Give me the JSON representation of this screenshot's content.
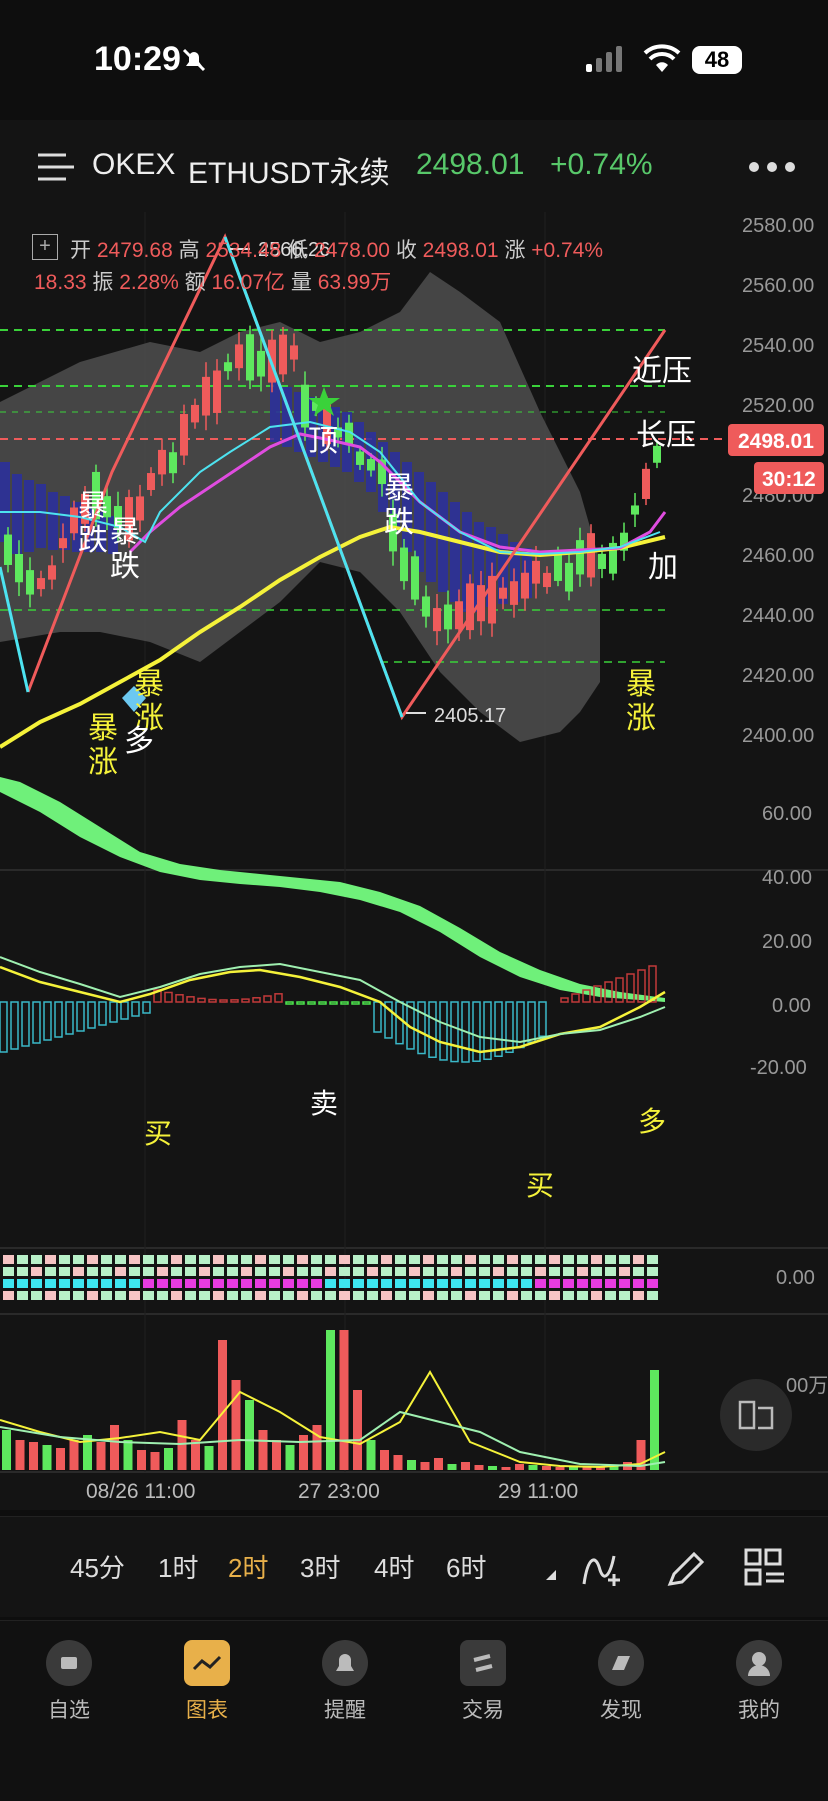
{
  "status_bar": {
    "time": "10:29",
    "battery": "48"
  },
  "header": {
    "exchange": "OKEX",
    "symbol": "ETHUSDT永续",
    "last_price": "2498.01",
    "change_pct": "+0.74%"
  },
  "ohlc": {
    "open_label": "开",
    "open": "2479.68",
    "high_label": "高",
    "high": "2534.48",
    "low_label": "低",
    "low": "2478.00",
    "close_label": "收",
    "close": "2498.01",
    "change_label": "涨",
    "change": "+0.74%",
    "change_abs": "18.33",
    "amplitude_label": "振",
    "amplitude": "2.28%",
    "turnover_label": "额",
    "turnover": "16.07亿",
    "volume_label": "量",
    "volume": "63.99万"
  },
  "price_axis": [
    "2580.00",
    "2560.00",
    "2540.00",
    "2520.00",
    "2500.00",
    "2480.00",
    "2460.00",
    "2440.00",
    "2420.00",
    "2400.00"
  ],
  "price_tags": {
    "current": "2498.01",
    "countdown": "30:12"
  },
  "marks": {
    "high_mark": "2566.26",
    "low_mark": "2405.17"
  },
  "chart_annotations": {
    "bao_die_1": "暴\n跌",
    "bao_die_2": "暴\n跌",
    "bao_die_3": "暴\n跌",
    "bao_zhang_1": "暴\n涨",
    "bao_zhang_2": "暴\n涨",
    "bao_zhang_3": "暴\n涨",
    "duo_1": "多",
    "ding": "顶",
    "jin_ya": "近压",
    "chang_ya": "长压",
    "jia": "加",
    "mai_buy_1": "买",
    "mai_sell": "卖",
    "mai_buy_2": "买",
    "duo_2": "多"
  },
  "osc_axis": [
    "60.00",
    "40.00",
    "20.00",
    "0.00",
    "-20.00"
  ],
  "dots_axis": "0.00",
  "vol_axis": "00万",
  "time_axis": [
    "08/26 11:00",
    "27 23:00",
    "29 11:00"
  ],
  "timeframes": {
    "items": [
      "45分",
      "1时",
      "2时",
      "3时",
      "4时",
      "6时"
    ],
    "selected": "2时"
  },
  "tabs": [
    {
      "label": "自选",
      "icon": "watchlist-icon"
    },
    {
      "label": "图表",
      "icon": "chart-icon"
    },
    {
      "label": "提醒",
      "icon": "bell-icon"
    },
    {
      "label": "交易",
      "icon": "trade-icon"
    },
    {
      "label": "发现",
      "icon": "discover-icon"
    },
    {
      "label": "我的",
      "icon": "profile-icon"
    }
  ],
  "colors": {
    "up": "#ef5b5b",
    "down": "#5ee85e",
    "accent": "#e8b04a",
    "yellow": "#f5f23a",
    "cyan": "#4de3f0",
    "magenta": "#e04ce0"
  }
}
